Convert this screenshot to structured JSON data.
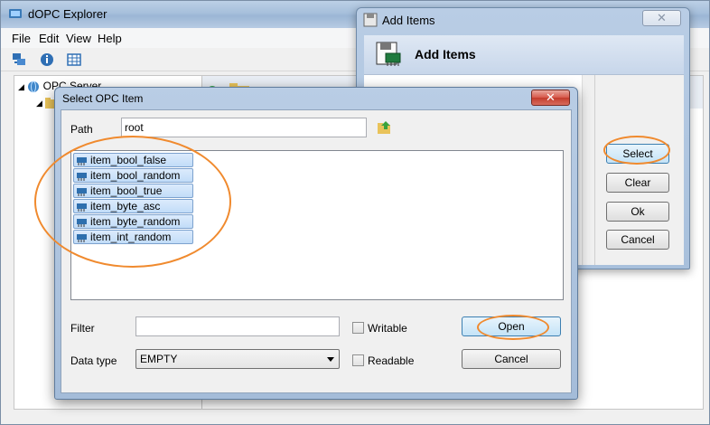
{
  "main_window": {
    "title": "dOPC Explorer",
    "menu": [
      "File",
      "Edit",
      "View",
      "Help"
    ],
    "tree": {
      "root_label": "OPC Server"
    },
    "right_header_text": "root"
  },
  "add_items_window": {
    "title": "Add Items",
    "header_title": "Add Items",
    "close_label": "✕",
    "buttons": {
      "select": "Select",
      "clear": "Clear",
      "ok": "Ok",
      "cancel": "Cancel"
    }
  },
  "select_opc_dialog": {
    "title": "Select OPC Item",
    "close_label": "✕",
    "path_label": "Path",
    "path_value": "root",
    "items": [
      "item_bool_false",
      "item_bool_random",
      "item_bool_true",
      "item_byte_asc",
      "item_byte_random",
      "item_int_random"
    ],
    "filter_label": "Filter",
    "filter_value": "",
    "writable_label": "Writable",
    "readable_label": "Readable",
    "data_type_label": "Data type",
    "data_type_value": "EMPTY",
    "buttons": {
      "open": "Open",
      "cancel": "Cancel"
    }
  },
  "colors": {
    "highlight_ellipse": "#f08a2e",
    "selection": "#c1dcf8"
  }
}
